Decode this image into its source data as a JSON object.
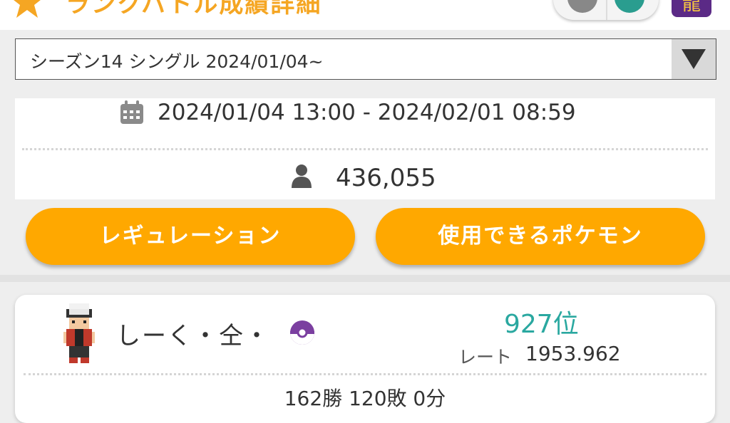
{
  "header": {
    "title": "ランクバトル成績詳細",
    "game_badge": "龍"
  },
  "season_select": {
    "value": "シーズン14 シングル 2024/01/04~"
  },
  "season_info": {
    "period": "2024/01/04 13:00 - 2024/02/01 08:59",
    "players": "436,055"
  },
  "buttons": {
    "regulation": "レギュレーション",
    "usable_pokemon": "使用できるポケモン"
  },
  "result": {
    "trainer_name": "しーく・仝・",
    "rank": "927位",
    "rate_label": "レート",
    "rate_value": "1953.962",
    "record": "162勝 120敗 0分"
  },
  "colors": {
    "accent_orange": "#ffa800",
    "rank_teal": "#2aa8a0"
  },
  "icons": [
    "badge-icon",
    "select-arrow-icon",
    "calendar-icon",
    "person-icon",
    "pokeball-icon"
  ]
}
